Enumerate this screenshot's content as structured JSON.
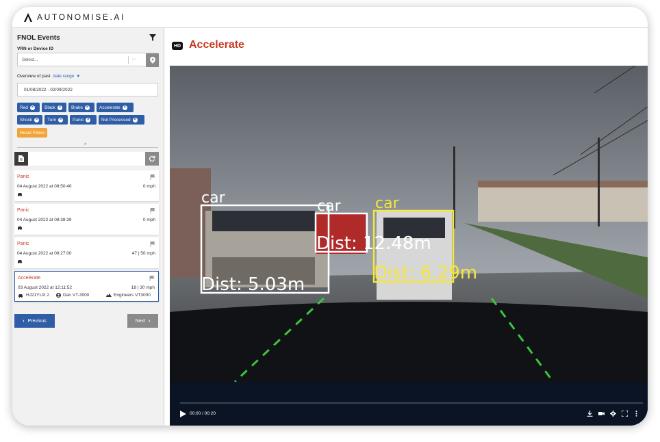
{
  "app": {
    "brand": "AUTONOMISE.AI"
  },
  "sidebar": {
    "title": "FNOL Events",
    "vrn_label": "VRN or Device ID",
    "select_placeholder": "Select...",
    "overview_prefix": "Overview of past",
    "date_range_link": "date range",
    "date_value": "01/08/2022 - 02/09/2022",
    "filters": [
      "Red",
      "Black",
      "Brake",
      "Accelerate",
      "Shock",
      "Turn",
      "Panic",
      "Not Processed"
    ],
    "reset_label": "Reset Filters",
    "events": [
      {
        "type": "Panic",
        "time": "04 August 2022 at 08:50:40",
        "speed": "0 mph"
      },
      {
        "type": "Panic",
        "time": "04 August 2022 at 08:38:39",
        "speed": "0 mph"
      },
      {
        "type": "Panic",
        "time": "04 August 2022 at 08:27:00",
        "speed": "47 | 50 mph"
      },
      {
        "type": "Accelerate",
        "time": "03 August 2022 at 12:11:52",
        "speed": "18 | 30 mph",
        "vrn": "HJ21YUX 2",
        "driver": "Dan VT-3000",
        "group": "Engineers VT3000"
      }
    ],
    "prev_label": "Previous",
    "next_label": "Next"
  },
  "main": {
    "badge": "HD",
    "title": "Accelerate",
    "detections": [
      {
        "label": "car",
        "dist": "Dist: 5.03m",
        "color": "#ffffff"
      },
      {
        "label": "car",
        "dist": "Dist: 12.48m",
        "color": "#ffffff"
      },
      {
        "label": "car",
        "dist": "Dist: 6.29m",
        "color": "#f5e83a"
      }
    ],
    "video_time": "00:00 / 00:20"
  }
}
